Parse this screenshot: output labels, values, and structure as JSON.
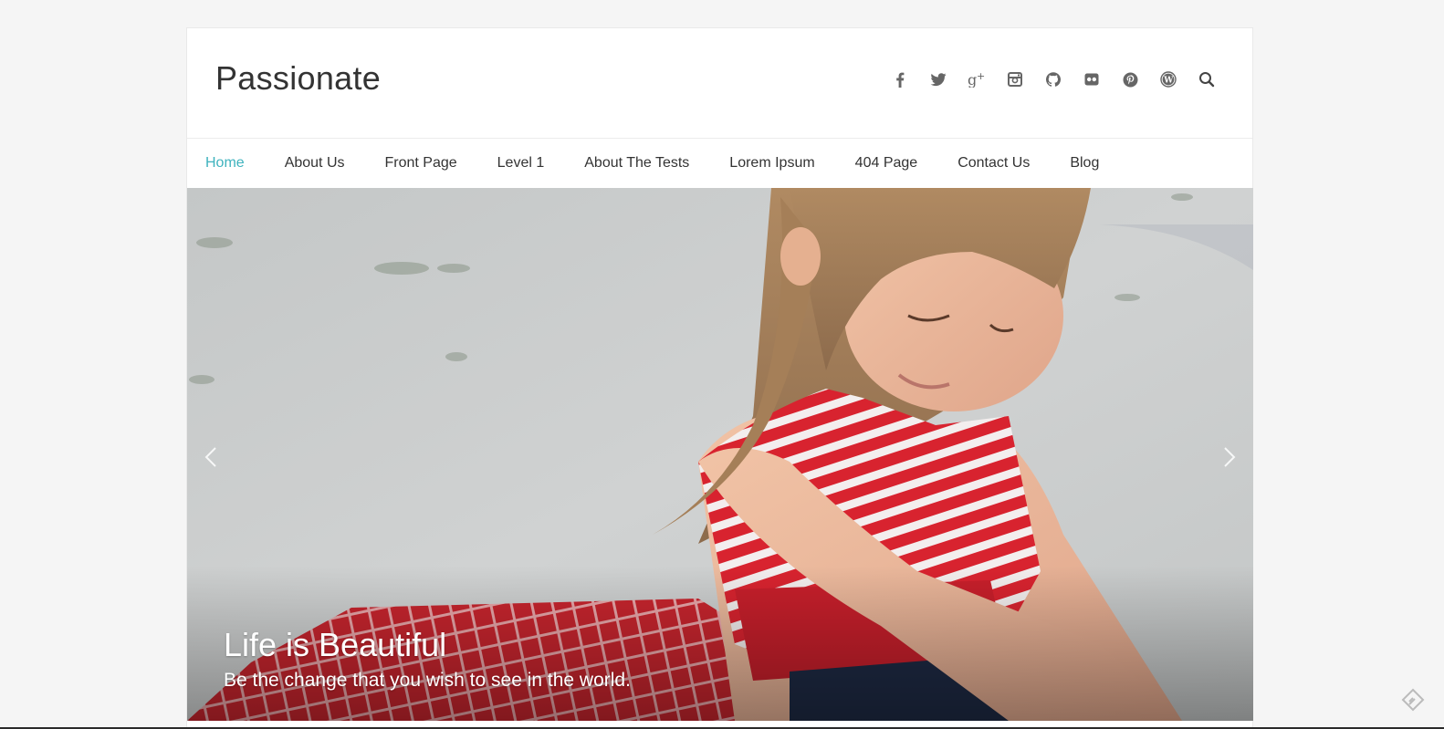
{
  "site": {
    "title": "Passionate"
  },
  "social_icons": [
    "facebook-icon",
    "twitter-icon",
    "google-plus-icon",
    "instagram-icon",
    "github-icon",
    "flickr-icon",
    "pinterest-icon",
    "wordpress-icon",
    "search-icon"
  ],
  "nav": {
    "items": [
      {
        "label": "Home",
        "active": true
      },
      {
        "label": "About Us"
      },
      {
        "label": "Front Page"
      },
      {
        "label": "Level 1"
      },
      {
        "label": "About The Tests"
      },
      {
        "label": "Lorem Ipsum"
      },
      {
        "label": "404 Page"
      },
      {
        "label": "Contact Us"
      },
      {
        "label": "Blog"
      }
    ]
  },
  "slider": {
    "title": "Life is Beautiful",
    "subtitle": "Be the change that you wish to see in the world."
  },
  "colors": {
    "accent": "#3fb3be",
    "text": "#333333",
    "icon": "#666666",
    "background": "#f5f5f5"
  }
}
